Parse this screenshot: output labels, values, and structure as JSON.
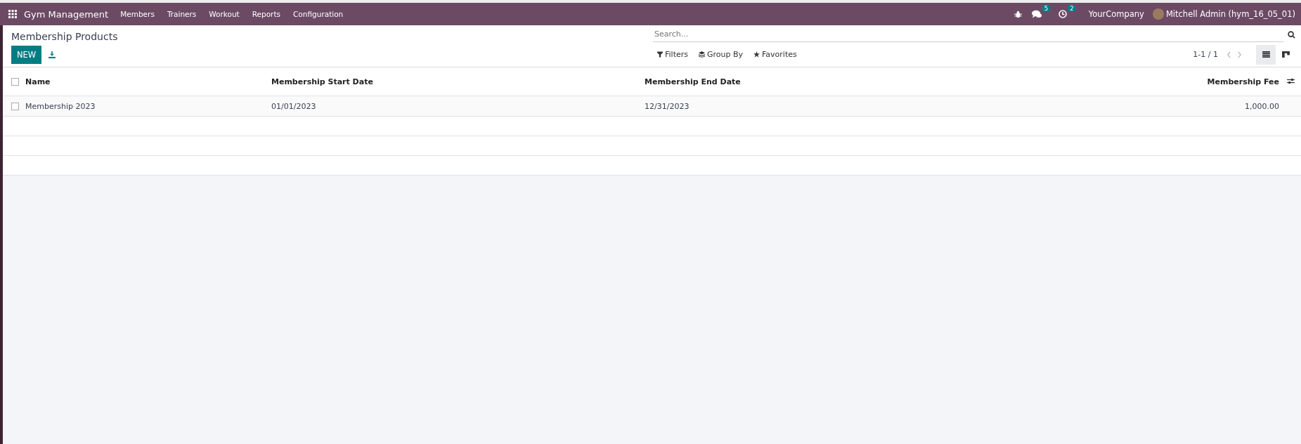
{
  "navbar": {
    "app_name": "Gym Management",
    "menus": [
      "Members",
      "Trainers",
      "Workout",
      "Reports",
      "Configuration"
    ]
  },
  "systray": {
    "messages_count": "5",
    "activities_count": "2",
    "company": "YourCompany",
    "user": "Mitchell Admin (hym_16_05_01)"
  },
  "control_panel": {
    "title": "Membership Products",
    "new_button": "NEW",
    "search": {
      "placeholder": "Search..."
    },
    "filters": [
      "Filters",
      "Group By",
      "Favorites"
    ],
    "pager": "1-1 / 1",
    "views": [
      {
        "kind": "list",
        "selected": true
      },
      {
        "kind": "kanban",
        "selected": false
      }
    ]
  },
  "table": {
    "all_checked": false,
    "columns": [
      "Name",
      "Membership Start Date",
      "Membership End Date",
      "Membership Fee"
    ],
    "rows": [
      {
        "checked": false,
        "cells": [
          "Membership 2023",
          "01/01/2023",
          "12/31/2023",
          "1,000.00"
        ]
      }
    ]
  }
}
